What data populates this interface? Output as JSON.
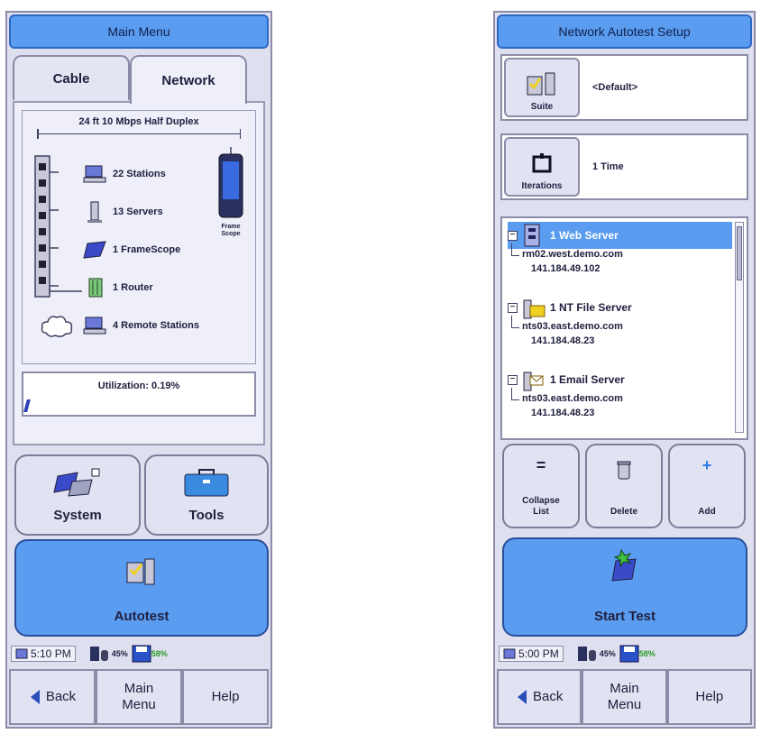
{
  "main_menu": {
    "title": "Main Menu",
    "tabs": [
      {
        "label": "Cable"
      },
      {
        "label": "Network"
      }
    ],
    "link_status": "24 ft 10 Mbps Half Duplex",
    "devices": [
      {
        "label": "22 Stations",
        "icon": "station-icon"
      },
      {
        "label": "13 Servers",
        "icon": "server-icon"
      },
      {
        "label": "1 FrameScope",
        "icon": "framescope-icon"
      },
      {
        "label": "1 Router",
        "icon": "router-icon"
      },
      {
        "label": "4 Remote Stations",
        "icon": "remote-station-icon"
      }
    ],
    "tester_label": "Frame Scope",
    "utilization": "Utilization: 0.19%",
    "utilization_level": 0.19,
    "buttons": {
      "system": "System",
      "tools": "Tools",
      "autotest": "Autotest"
    },
    "status": {
      "time": "5:10 PM",
      "battery": "45%",
      "storage": "58%"
    },
    "nav": {
      "back": "Back",
      "main_menu": "Main Menu",
      "help": "Help"
    }
  },
  "setup": {
    "title": "Network Autotest Setup",
    "suite": {
      "label": "Suite",
      "value": "<Default>"
    },
    "iterations": {
      "label": "Iterations",
      "value": "1 Time"
    },
    "servers": [
      {
        "name": "1 Web Server",
        "host": "rm02.west.demo.com",
        "ip": "141.184.49.102",
        "selected": true,
        "icon": "web-server-icon"
      },
      {
        "name": "1 NT File Server",
        "host": "nts03.east.demo.com",
        "ip": "141.184.48.23",
        "selected": false,
        "icon": "file-server-icon"
      },
      {
        "name": "1 Email Server",
        "host": "nts03.east.demo.com",
        "ip": "141.184.48.23",
        "selected": false,
        "icon": "email-server-icon"
      }
    ],
    "buttons": {
      "collapse": "Collapse List",
      "delete": "Delete",
      "add": "Add",
      "start": "Start Test"
    },
    "status": {
      "time": "5:00 PM",
      "battery": "45%",
      "storage": "58%"
    },
    "nav": {
      "back": "Back",
      "main_menu": "Main Menu",
      "help": "Help"
    }
  },
  "colors": {
    "accent": "#5a9cf0",
    "panel": "#dfe0ef",
    "storage_green": "#2a9a2a"
  }
}
